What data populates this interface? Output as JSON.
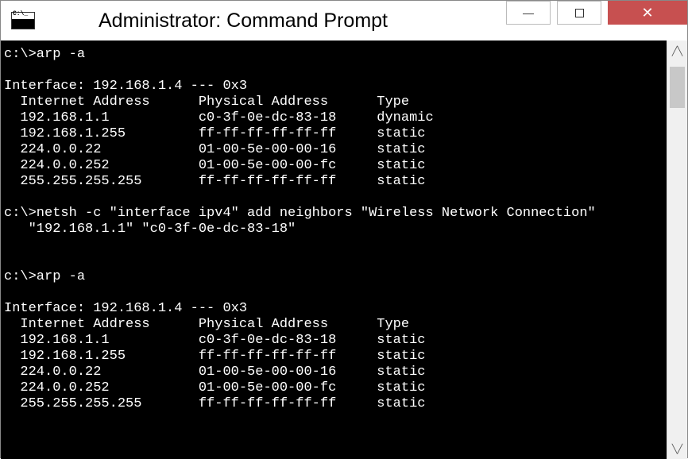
{
  "window": {
    "title": "Administrator: Command Prompt"
  },
  "session": {
    "prompt": "c:\\>",
    "blocks": [
      {
        "command": "arp -a",
        "blank_after_command": true,
        "interface_header": "Interface: 192.168.1.4 --- 0x3",
        "columns": {
          "col1": "Internet Address",
          "col2": "Physical Address",
          "col3": "Type"
        },
        "rows": [
          {
            "ip": "192.168.1.1",
            "mac": "c0-3f-0e-dc-83-18",
            "type": "dynamic"
          },
          {
            "ip": "192.168.1.255",
            "mac": "ff-ff-ff-ff-ff-ff",
            "type": "static"
          },
          {
            "ip": "224.0.0.22",
            "mac": "01-00-5e-00-00-16",
            "type": "static"
          },
          {
            "ip": "224.0.0.252",
            "mac": "01-00-5e-00-00-fc",
            "type": "static"
          },
          {
            "ip": "255.255.255.255",
            "mac": "ff-ff-ff-ff-ff-ff",
            "type": "static"
          }
        ]
      },
      {
        "command": "netsh -c \"interface ipv4\" add neighbors \"Wireless Network Connection\"",
        "continuation": "   \"192.168.1.1\" \"c0-3f-0e-dc-83-18\"",
        "blank_after_command": false
      },
      {
        "command": "arp -a",
        "blank_after_command": true,
        "pre_blank_lines": 2,
        "interface_header": "Interface: 192.168.1.4 --- 0x3",
        "columns": {
          "col1": "Internet Address",
          "col2": "Physical Address",
          "col3": "Type"
        },
        "rows": [
          {
            "ip": "192.168.1.1",
            "mac": "c0-3f-0e-dc-83-18",
            "type": "static"
          },
          {
            "ip": "192.168.1.255",
            "mac": "ff-ff-ff-ff-ff-ff",
            "type": "static"
          },
          {
            "ip": "224.0.0.22",
            "mac": "01-00-5e-00-00-16",
            "type": "static"
          },
          {
            "ip": "224.0.0.252",
            "mac": "01-00-5e-00-00-fc",
            "type": "static"
          },
          {
            "ip": "255.255.255.255",
            "mac": "ff-ff-ff-ff-ff-ff",
            "type": "static"
          }
        ]
      }
    ]
  }
}
